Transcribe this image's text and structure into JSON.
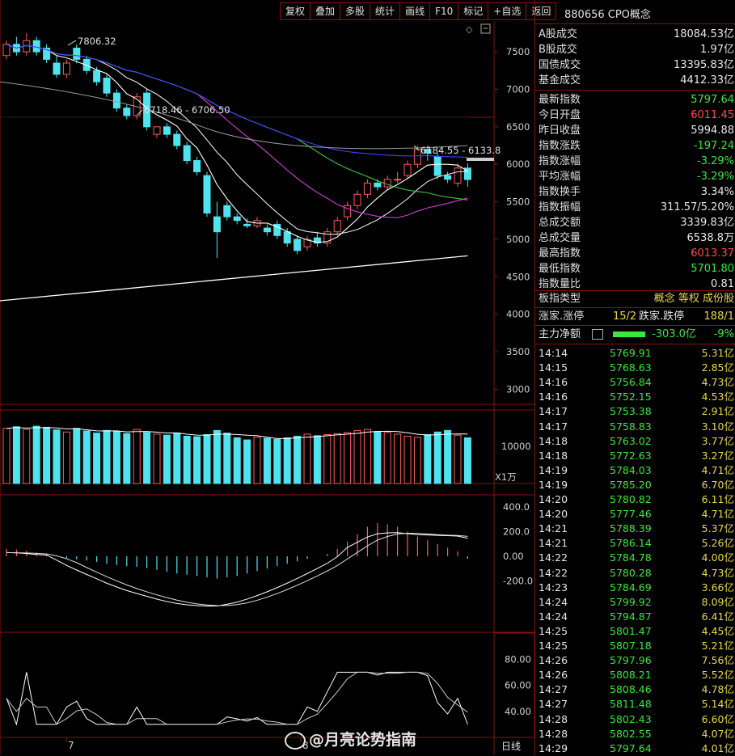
{
  "toolbar": {
    "buttons": [
      "复权",
      "叠加",
      "多股",
      "统计",
      "画线",
      "F10",
      "标记",
      "+自选",
      "返回"
    ]
  },
  "panel": {
    "title": "880656 CPO概念",
    "stats": [
      {
        "label": "A股成交",
        "value": "18084.53亿",
        "color": "w"
      },
      {
        "label": "B股成交",
        "value": "1.97亿",
        "color": "w"
      },
      {
        "label": "国债成交",
        "value": "13395.83亿",
        "color": "w"
      },
      {
        "label": "基金成交",
        "value": "4412.33亿",
        "color": "w"
      },
      {
        "label": "最新指数",
        "value": "5797.64",
        "color": "g"
      },
      {
        "label": "今日开盘",
        "value": "6011.45",
        "color": "r"
      },
      {
        "label": "昨日收盘",
        "value": "5994.88",
        "color": "w"
      },
      {
        "label": "指数涨跌",
        "value": "-197.24",
        "color": "g"
      },
      {
        "label": "指数涨幅",
        "value": "-3.29%",
        "color": "g"
      },
      {
        "label": "平均涨幅",
        "value": "-3.29%",
        "color": "g"
      },
      {
        "label": "指数换手",
        "value": "3.34%",
        "color": "w"
      },
      {
        "label": "指数振幅",
        "value": "311.57/5.20%",
        "color": "w"
      },
      {
        "label": "总成交额",
        "value": "3339.83亿",
        "color": "w"
      },
      {
        "label": "总成交量",
        "value": "6538.8万",
        "color": "w"
      },
      {
        "label": "最高指数",
        "value": "6013.37",
        "color": "r"
      },
      {
        "label": "最低指数",
        "value": "5701.80",
        "color": "g"
      },
      {
        "label": "指数量比",
        "value": "0.81",
        "color": "w"
      }
    ],
    "type_label": "板指类型",
    "type_value": "概念 等权 成份股",
    "updown_label1": "涨家.涨停",
    "updown_val1": "15/2",
    "updown_label2": "跌家.跌停",
    "updown_val2": "188/1",
    "flow_label": "主力净额",
    "flow_value": "-303.0亿",
    "flow_pct": "-9%",
    "ticks": [
      [
        "14:14",
        "5769.91",
        "5.31亿"
      ],
      [
        "14:15",
        "5768.63",
        "2.85亿"
      ],
      [
        "14:16",
        "5756.84",
        "4.73亿"
      ],
      [
        "14:16",
        "5752.15",
        "4.53亿"
      ],
      [
        "14:17",
        "5753.38",
        "2.91亿"
      ],
      [
        "14:17",
        "5758.83",
        "3.10亿"
      ],
      [
        "14:18",
        "5763.02",
        "3.77亿"
      ],
      [
        "14:18",
        "5772.63",
        "3.27亿"
      ],
      [
        "14:19",
        "5784.03",
        "4.71亿"
      ],
      [
        "14:19",
        "5785.20",
        "6.70亿"
      ],
      [
        "14:20",
        "5780.82",
        "6.11亿"
      ],
      [
        "14:20",
        "5777.46",
        "4.71亿"
      ],
      [
        "14:21",
        "5788.39",
        "5.37亿"
      ],
      [
        "14:21",
        "5786.14",
        "5.26亿"
      ],
      [
        "14:22",
        "5784.78",
        "4.00亿"
      ],
      [
        "14:22",
        "5780.28",
        "4.73亿"
      ],
      [
        "14:23",
        "5784.69",
        "3.66亿"
      ],
      [
        "14:24",
        "5799.92",
        "8.09亿"
      ],
      [
        "14:24",
        "5794.87",
        "6.41亿"
      ],
      [
        "14:25",
        "5801.47",
        "4.45亿"
      ],
      [
        "14:25",
        "5807.18",
        "5.21亿"
      ],
      [
        "14:26",
        "5797.96",
        "7.56亿"
      ],
      [
        "14:26",
        "5808.21",
        "5.52亿"
      ],
      [
        "14:27",
        "5808.46",
        "4.78亿"
      ],
      [
        "14:27",
        "5811.48",
        "5.14亿"
      ],
      [
        "14:28",
        "5802.43",
        "6.60亿"
      ],
      [
        "14:28",
        "5802.55",
        "4.07亿"
      ],
      [
        "14:29",
        "5797.64",
        "4.01亿"
      ]
    ]
  },
  "chart": {
    "price_ticks": [
      "7500",
      "7000",
      "6500",
      "6000",
      "5500",
      "5000",
      "4500",
      "4000",
      "3500",
      "3000"
    ],
    "vol_tick": "10000",
    "vol_unit": "X1万",
    "macd_ticks": [
      "400.0",
      "200.0",
      "0.00",
      "-200.0"
    ],
    "kdj_ticks": [
      "80.00",
      "60.00",
      "40.00"
    ],
    "high_label": "7806.32",
    "range_label1": "6718.46 - 6706.50",
    "range_label2": "6184.55 - 6133.8",
    "x_labels": [
      "7",
      "8"
    ],
    "period": "日线",
    "watermark": "@月亮论势指南"
  },
  "chart_data": {
    "type": "candlestick",
    "series_open": [
      7450,
      7600,
      7500,
      7650,
      7550,
      7350,
      7200,
      7550,
      7400,
      7250,
      7150,
      6950,
      6750,
      6650,
      6950,
      6400,
      6500,
      6400,
      6250,
      6050,
      5850,
      5300,
      5450,
      5300,
      5200,
      5180,
      5150,
      5200,
      5100,
      5000,
      4900,
      5020,
      4950,
      5100,
      5300,
      5450,
      5600,
      5750,
      5700,
      5800,
      5850,
      6000,
      6200,
      6100,
      5850,
      5750,
      5950
    ],
    "series_close": [
      7600,
      7500,
      7650,
      7500,
      7400,
      7200,
      7350,
      7400,
      7250,
      7100,
      6950,
      6750,
      6650,
      6900,
      6500,
      6500,
      6400,
      6250,
      6050,
      5900,
      5350,
      5100,
      5300,
      5250,
      5180,
      5250,
      5100,
      5050,
      4950,
      4850,
      5000,
      4950,
      5100,
      5250,
      5450,
      5600,
      5750,
      5700,
      5800,
      5800,
      6000,
      6200,
      6150,
      5850,
      5800,
      5950,
      5797
    ],
    "series_high": [
      7650,
      7700,
      7750,
      7700,
      7600,
      7450,
      7400,
      7600,
      7450,
      7300,
      7200,
      7000,
      6800,
      6950,
      7000,
      6500,
      6550,
      6450,
      6300,
      6100,
      5900,
      5500,
      5500,
      5350,
      5280,
      5300,
      5200,
      5250,
      5150,
      5050,
      5050,
      5100,
      5150,
      5300,
      5500,
      5650,
      5800,
      5800,
      5850,
      5900,
      6050,
      6250,
      6250,
      6150,
      5900,
      6013,
      6013
    ],
    "series_low": [
      7400,
      7450,
      7450,
      7450,
      7350,
      7150,
      7150,
      7350,
      7200,
      7050,
      6900,
      6700,
      6600,
      6600,
      6450,
      6350,
      6350,
      6200,
      6000,
      5850,
      5300,
      4750,
      5250,
      5200,
      5150,
      5150,
      5050,
      5000,
      4900,
      4800,
      4850,
      4900,
      4900,
      5050,
      5250,
      5400,
      5550,
      5650,
      5650,
      5750,
      5800,
      5950,
      6050,
      5800,
      5750,
      5700,
      5701
    ],
    "volume": [
      10500,
      10800,
      10300,
      10900,
      10700,
      10200,
      9800,
      10500,
      10000,
      9600,
      10100,
      9900,
      9500,
      10300,
      9700,
      9400,
      9200,
      9600,
      9000,
      8900,
      9300,
      10100,
      9600,
      8700,
      8300,
      8800,
      8600,
      8400,
      8700,
      9000,
      9400,
      9100,
      9300,
      9500,
      9700,
      10100,
      10300,
      9900,
      9700,
      9400,
      9000,
      8800,
      9300,
      9800,
      10100,
      9200,
      8700
    ],
    "price_range": [
      2800,
      7900
    ],
    "vol_range": [
      0,
      14000
    ],
    "macd_range": [
      -400,
      400
    ],
    "kdj_range": [
      20,
      100
    ],
    "macd_hist": [
      60,
      55,
      45,
      30,
      20,
      5,
      -15,
      -25,
      -35,
      -45,
      -60,
      -70,
      -80,
      -85,
      -95,
      -110,
      -125,
      -140,
      -150,
      -160,
      -170,
      -180,
      -170,
      -160,
      -140,
      -120,
      -100,
      -80,
      -60,
      -40,
      -20,
      0,
      20,
      60,
      120,
      180,
      240,
      270,
      260,
      240,
      200,
      160,
      130,
      100,
      70,
      40,
      -20
    ]
  }
}
